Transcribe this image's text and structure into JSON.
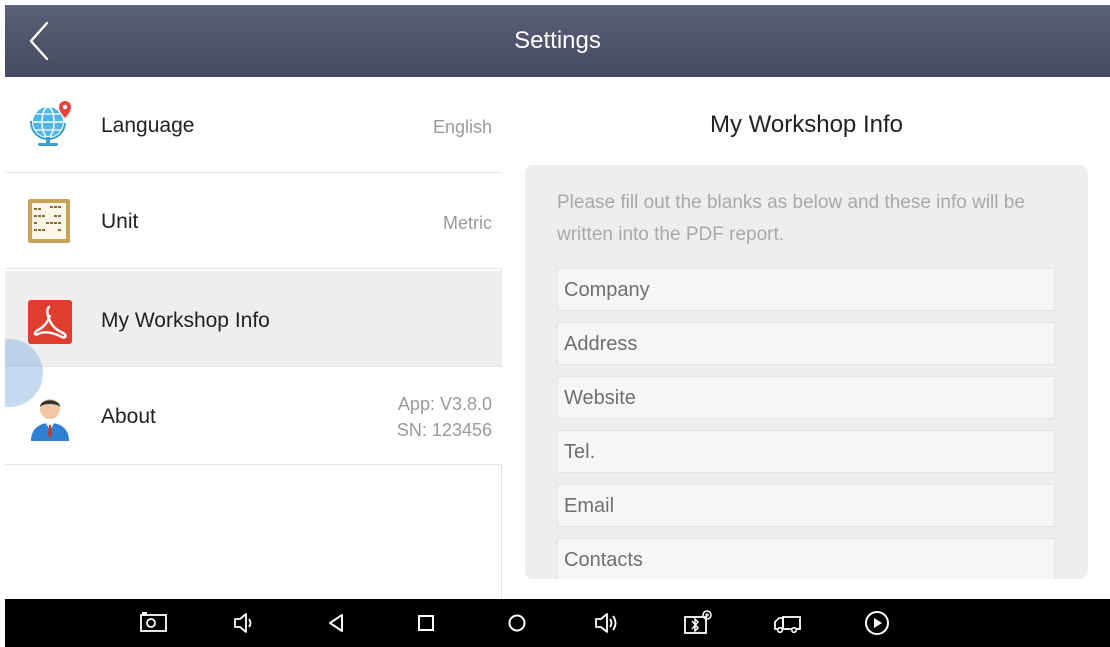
{
  "header": {
    "title": "Settings"
  },
  "menu": {
    "items": [
      {
        "label": "Language",
        "value": "English",
        "icon": "globe-pin-icon"
      },
      {
        "label": "Unit",
        "value": "Metric",
        "icon": "abacus-icon"
      },
      {
        "label": "My Workshop Info",
        "value": "",
        "icon": "pdf-icon"
      },
      {
        "label": "About",
        "value_line1": "App: V3.8.0",
        "value_line2": "SN: 123456",
        "icon": "user-icon"
      }
    ],
    "active_index": 2
  },
  "workshop": {
    "title": "My Workshop Info",
    "description": "Please fill out the blanks as below and these info will be written into the PDF report.",
    "fields": [
      {
        "placeholder": "Company"
      },
      {
        "placeholder": "Address"
      },
      {
        "placeholder": "Website"
      },
      {
        "placeholder": "Tel."
      },
      {
        "placeholder": "Email"
      },
      {
        "placeholder": "Contacts"
      }
    ]
  },
  "navbar": {
    "buttons": [
      "screenshot-icon",
      "volume-down-icon",
      "back-icon",
      "recents-icon",
      "home-icon",
      "volume-up-icon",
      "vci-bluetooth-icon",
      "truck-icon",
      "play-icon"
    ]
  },
  "colors": {
    "header": "#4f546b",
    "active_item": "#eeeeee",
    "card": "#eeeeee",
    "navbar": "#000000"
  }
}
